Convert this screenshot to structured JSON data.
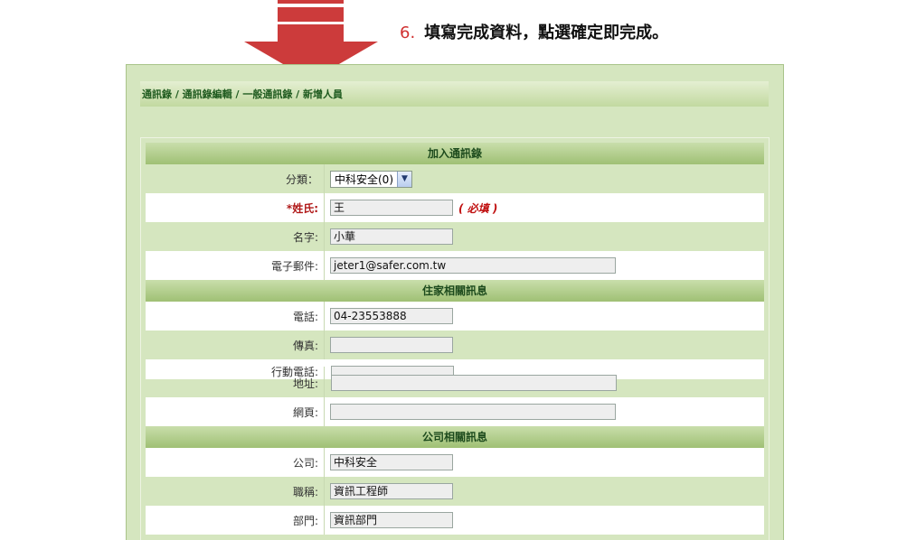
{
  "instruction": {
    "step_number": "6.",
    "text": "填寫完成資料，點選確定即完成。"
  },
  "breadcrumb": "通訊錄 / 通訊錄編輯 / 一般通訊錄 / 新增人員",
  "sections": {
    "join": "加入通訊錄",
    "home": "住家相關訊息",
    "company": "公司相關訊息"
  },
  "fields": {
    "category": {
      "label": "分類：",
      "value": "中科安全(0)"
    },
    "surname": {
      "label": "*姓氏:",
      "value": "王",
      "note": "( 必填 )"
    },
    "given_name": {
      "label": "名字:",
      "value": "小華"
    },
    "email": {
      "label": "電子郵件:",
      "value": "jeter1@safer.com.tw"
    },
    "phone": {
      "label": "電話:",
      "value": "04-23553888"
    },
    "fax": {
      "label": "傳真:",
      "value": ""
    },
    "mobile": {
      "label": "行動電話:",
      "value": ""
    },
    "address": {
      "label": "地址:",
      "value": ""
    },
    "homepage": {
      "label": "網頁:",
      "value": ""
    },
    "company": {
      "label": "公司:",
      "value": "中科安全"
    },
    "job_title": {
      "label": "職稱:",
      "value": "資訊工程師"
    },
    "department": {
      "label": "部門:",
      "value": "資訊部門"
    }
  },
  "icons": {
    "dropdown": "chevron-down-icon",
    "arrow": "down-arrow-icon"
  },
  "colors": {
    "arrow": "#cc3b3b",
    "panel": "#d5e6bf",
    "header_green": "#9fc074",
    "required_red": "#c01010"
  }
}
